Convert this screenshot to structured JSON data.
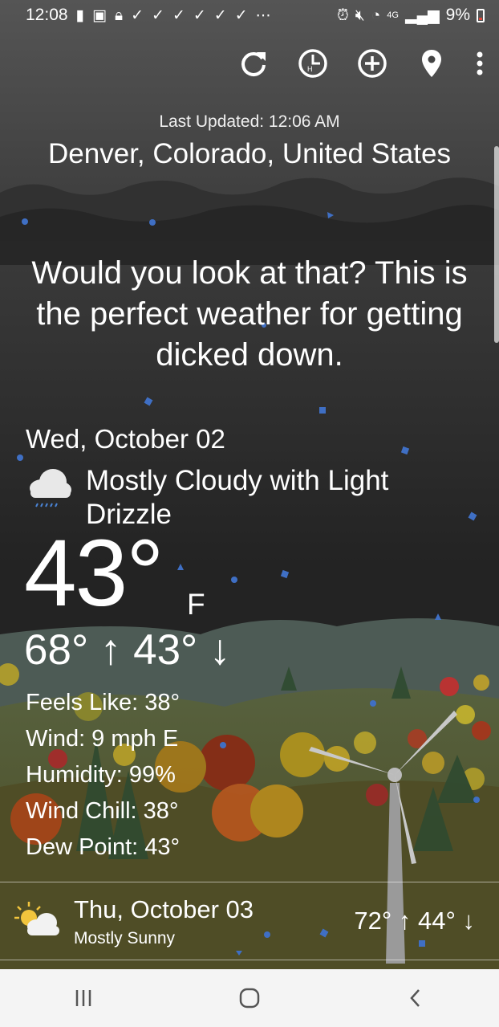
{
  "status_bar": {
    "time": "12:08",
    "network": "4G",
    "battery": "9%",
    "icons_left": [
      "alert-icon",
      "gallery-icon",
      "lock-icon",
      "check-icon",
      "check-icon",
      "check-icon",
      "check-icon",
      "check-icon",
      "check-icon",
      "more-icon"
    ],
    "icons_right": [
      "alarm-icon",
      "mute-icon",
      "wifi-icon",
      "signal-icon",
      "battery-icon"
    ]
  },
  "toolbar": {
    "buttons": [
      "refresh-icon",
      "history-icon",
      "add-location-icon",
      "location-pin-icon",
      "overflow-menu-icon"
    ]
  },
  "header": {
    "last_updated": "Last Updated: 12:06 AM",
    "location": "Denver, Colorado, United States"
  },
  "quote": "Would you look at that? This is the perfect weather for getting dicked down.",
  "current": {
    "date": "Wed, October 02",
    "condition": "Mostly Cloudy with Light Drizzle",
    "condition_icon": "cloud-drizzle-icon",
    "temperature": "43°",
    "unit": "F",
    "hilo": "68° ↑ 43° ↓",
    "details": [
      "Feels Like: 38°",
      "Wind: 9 mph E",
      "Humidity: 99%",
      "Wind Chill: 38°",
      "Dew Point: 43°"
    ]
  },
  "forecast": [
    {
      "date": "Thu, October 03",
      "condition": "Mostly Sunny",
      "icon": "sun-cloud-icon",
      "hilo": "72° ↑ 44° ↓"
    }
  ],
  "nav_bar": {
    "buttons": [
      "recent-apps-icon",
      "home-icon",
      "back-icon"
    ]
  },
  "colors": {
    "sky": "#2b2b2b",
    "mountain": "#4b5a54",
    "hill": "#5a5a30",
    "accent_dot": "#3f6fc4",
    "navbar": "#f4f4f4"
  }
}
